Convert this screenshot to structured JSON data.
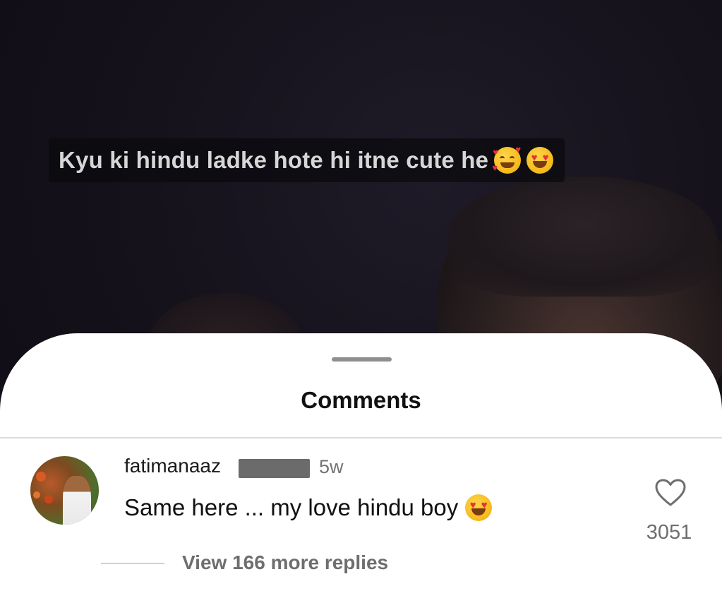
{
  "video": {
    "caption": "Kyu ki hindu ladke hote hi itne cute he",
    "caption_emojis": [
      "smiling-face-with-hearts",
      "heart-eyes"
    ]
  },
  "comments_sheet": {
    "title": "Comments",
    "comment": {
      "username": "fatimanaaz",
      "username_redacted": true,
      "timestamp": "5w",
      "text": "Same here ... my love hindu boy",
      "text_emoji": "heart-eyes",
      "like_icon": "heart-outline-icon",
      "like_count": "3051",
      "view_replies_label": "View 166 more replies"
    }
  },
  "colors": {
    "sheet_background": "#ffffff",
    "video_background": "#15121c",
    "secondary_text": "#6e6e6e"
  }
}
